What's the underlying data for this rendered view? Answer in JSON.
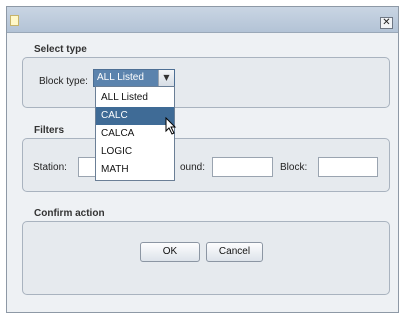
{
  "window": {
    "close_glyph": "✕"
  },
  "select_type": {
    "heading": "Select type",
    "block_type_label": "Block type:",
    "selected_value": "ALL Listed",
    "options": [
      "ALL Listed",
      "CALC",
      "CALCA",
      "LOGIC",
      "MATH"
    ],
    "highlighted_option": "CALC"
  },
  "filters": {
    "heading": "Filters",
    "station_label": "Station:",
    "compound_label_visible": "ound:",
    "block_label": "Block:",
    "station_value": "",
    "compound_value": "",
    "block_value": ""
  },
  "confirm": {
    "heading": "Confirm action",
    "ok_label": "OK",
    "cancel_label": "Cancel"
  },
  "colors": {
    "title_bar": "#b8c8da",
    "dialog_background": "#eef1f4",
    "selection": "#3f6b96"
  }
}
